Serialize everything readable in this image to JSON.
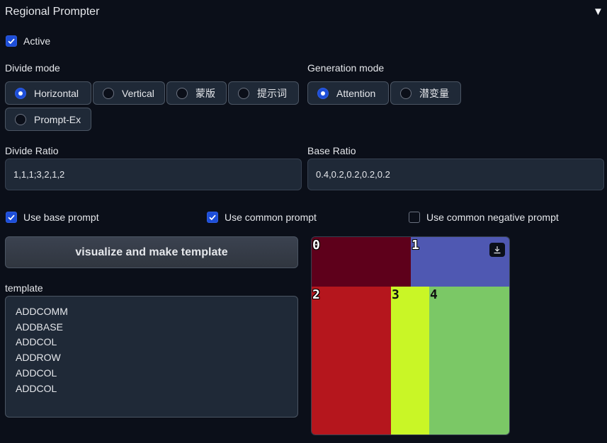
{
  "header": {
    "title": "Regional Prompter",
    "collapse_icon": "triangle-down-icon"
  },
  "active": {
    "label": "Active",
    "checked": true
  },
  "divide_mode": {
    "label": "Divide mode",
    "options": [
      {
        "label": "Horizontal",
        "selected": true
      },
      {
        "label": "Vertical",
        "selected": false
      },
      {
        "label": "蒙版",
        "selected": false
      },
      {
        "label": "提示词",
        "selected": false
      },
      {
        "label": "Prompt-Ex",
        "selected": false
      }
    ]
  },
  "generation_mode": {
    "label": "Generation mode",
    "options": [
      {
        "label": "Attention",
        "selected": true
      },
      {
        "label": "潜变量",
        "selected": false
      }
    ]
  },
  "divide_ratio": {
    "label": "Divide Ratio",
    "value": "1,1,1;3,2,1,2"
  },
  "base_ratio": {
    "label": "Base Ratio",
    "value": "0.4,0.2,0.2,0.2,0.2"
  },
  "options": {
    "use_base_prompt": {
      "label": "Use base prompt",
      "checked": true
    },
    "use_common_prompt": {
      "label": "Use common prompt",
      "checked": true
    },
    "use_common_negative_prompt": {
      "label": "Use common negative prompt",
      "checked": false
    }
  },
  "visualize_button": {
    "label": "visualize and make template"
  },
  "template": {
    "label": "template",
    "lines": [
      "ADDCOMM",
      "ADDBASE",
      "ADDCOL",
      "ADDROW",
      "ADDCOL",
      "ADDCOL"
    ]
  },
  "preview": {
    "download_icon": "download-icon",
    "regions": [
      {
        "label": "0",
        "color": "#5e001b"
      },
      {
        "label": "1",
        "color": "#4f58b2"
      },
      {
        "label": "2",
        "color": "#b5161d"
      },
      {
        "label": "3",
        "color": "#c9f626"
      },
      {
        "label": "4",
        "color": "#7bc866"
      }
    ]
  },
  "colors": {
    "background": "#0b0f19",
    "accent": "#1d4ed8",
    "panel": "#1f2937"
  }
}
